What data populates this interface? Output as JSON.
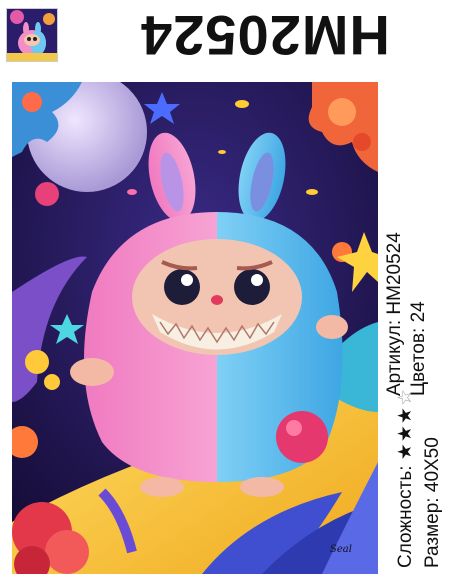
{
  "header": {
    "code": "HM20524"
  },
  "info": {
    "article_label": "Артикул:",
    "article_value": "HM20524",
    "colors_label": "Цветов:",
    "colors_value": "24",
    "difficulty_label": "Сложность:",
    "difficulty_level": 3,
    "difficulty_max": 4,
    "size_label": "Размер:",
    "size_value": "40X50"
  },
  "artwork": {
    "signature": "Seal",
    "subject": "fluffy pink-and-blue bunny-eared monster"
  }
}
